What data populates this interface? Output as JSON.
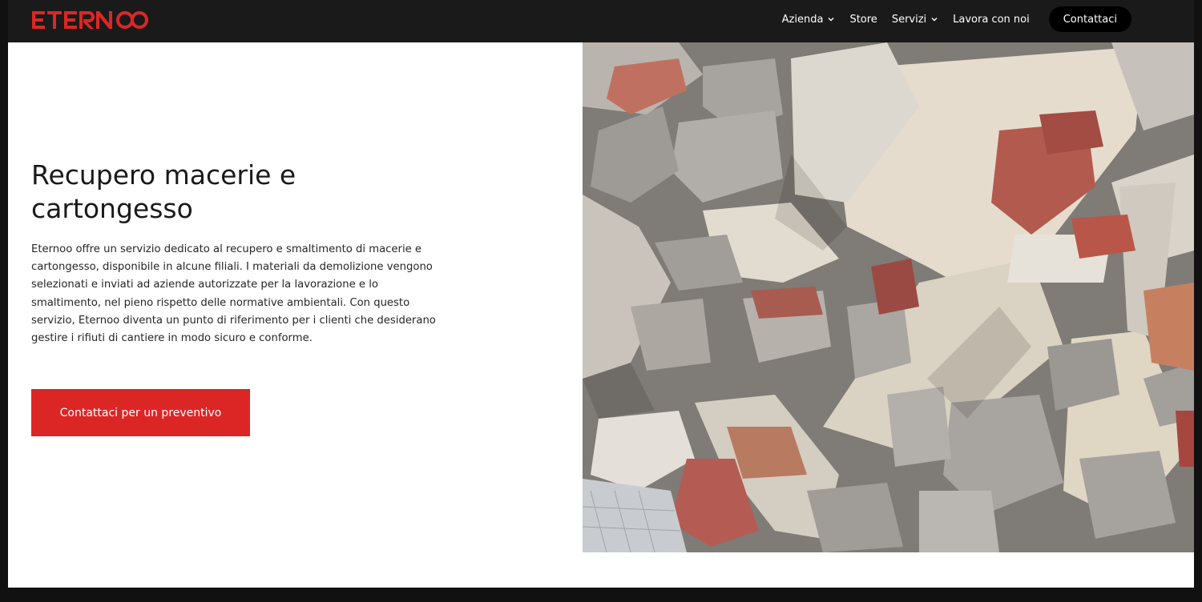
{
  "brand": {
    "name": "ETERNOO",
    "accent": "#dc2626"
  },
  "nav": {
    "items": [
      {
        "label": "Azienda",
        "dropdown": true
      },
      {
        "label": "Store",
        "dropdown": false
      },
      {
        "label": "Servizi",
        "dropdown": true
      },
      {
        "label": "Lavora con noi",
        "dropdown": false
      }
    ],
    "cta_label": "Contattaci"
  },
  "hero": {
    "title": "Recupero macerie e cartongesso",
    "body": "Eternoo offre un servizio dedicato al recupero e smaltimento di macerie e cartongesso, disponibile in alcune filiali. I materiali da demolizione vengono selezionati e inviati ad aziende autorizzate per la lavorazione e lo smaltimento, nel pieno rispetto delle normative ambientali. Con questo servizio, Eternoo diventa un punto di riferimento per i clienti che desiderano gestire i rifiuti di cantiere in modo sicuro e conforme.",
    "cta_label": "Contattaci per un preventivo",
    "image_icon": "rubble-photo"
  },
  "colors": {
    "topbar": "#1a1a1a",
    "button": "#dc2626",
    "text": "#1a1a1a"
  }
}
